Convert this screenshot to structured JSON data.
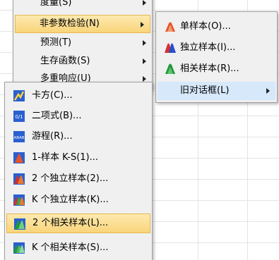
{
  "analyze_menu": {
    "items": [
      {
        "label": "度量(S)"
      },
      {
        "label": "非参数检验(N)"
      },
      {
        "label": "预测(T)"
      },
      {
        "label": "生存函数(S)"
      },
      {
        "label": "多重响应(U)"
      }
    ]
  },
  "nonparametric_menu": {
    "items": [
      {
        "label": "单样本(O)...",
        "icon": "one-sample-icon"
      },
      {
        "label": "独立样本(I)...",
        "icon": "independent-samples-icon"
      },
      {
        "label": "相关样本(R)...",
        "icon": "related-samples-icon"
      },
      {
        "label": "旧对话框(L)"
      }
    ]
  },
  "legacy_menu": {
    "items": [
      {
        "label": "卡方(C)...",
        "icon": "chi-square-icon"
      },
      {
        "label": "二项式(B)...",
        "icon": "binomial-icon"
      },
      {
        "label": "游程(R)...",
        "icon": "runs-icon"
      },
      {
        "label": "1-样本 K-S(1)...",
        "icon": "ks-one-sample-icon"
      },
      {
        "label": "2 个独立样本(2)...",
        "icon": "two-independent-samples-icon"
      },
      {
        "label": "K 个独立样本(K)...",
        "icon": "k-independent-samples-icon"
      },
      {
        "label": "2 个相关样本(L)...",
        "icon": "two-related-samples-icon"
      },
      {
        "label": "K 个相关样本(S)...",
        "icon": "k-related-samples-icon"
      }
    ]
  },
  "colors": {
    "menu_bg": "#f0f0f0",
    "highlight_orange": "#f9d57a",
    "highlight_blue": "#d6e8fa"
  }
}
